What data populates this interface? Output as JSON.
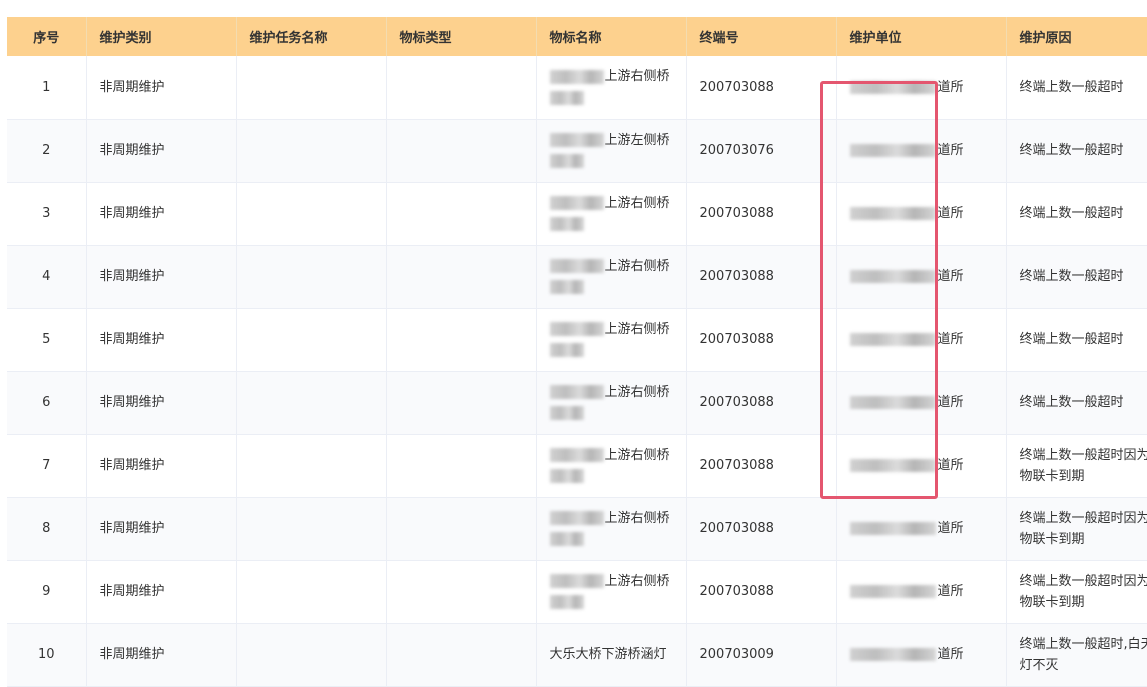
{
  "table": {
    "columns": [
      "序号",
      "维护类别",
      "维护任务名称",
      "物标类型",
      "物标名称",
      "终端号",
      "维护单位",
      "维护原因"
    ],
    "rows": [
      {
        "idx": "1",
        "category": "非周期维护",
        "task": "",
        "type": "",
        "name_suffix": "上游右侧桥",
        "name": "",
        "terminal": "200703088",
        "unit_suffix": "道所",
        "reason": "终端上数一般超时"
      },
      {
        "idx": "2",
        "category": "非周期维护",
        "task": "",
        "type": "",
        "name_suffix": "上游左侧桥",
        "name": "",
        "terminal": "200703076",
        "unit_suffix": "道所",
        "reason": "终端上数一般超时"
      },
      {
        "idx": "3",
        "category": "非周期维护",
        "task": "",
        "type": "",
        "name_suffix": "上游右侧桥",
        "name": "",
        "terminal": "200703088",
        "unit_suffix": "道所",
        "reason": "终端上数一般超时"
      },
      {
        "idx": "4",
        "category": "非周期维护",
        "task": "",
        "type": "",
        "name_suffix": "上游右侧桥",
        "name": "",
        "terminal": "200703088",
        "unit_suffix": "道所",
        "reason": "终端上数一般超时"
      },
      {
        "idx": "5",
        "category": "非周期维护",
        "task": "",
        "type": "",
        "name_suffix": "上游右侧桥",
        "name": "",
        "terminal": "200703088",
        "unit_suffix": "道所",
        "reason": "终端上数一般超时"
      },
      {
        "idx": "6",
        "category": "非周期维护",
        "task": "",
        "type": "",
        "name_suffix": "上游右侧桥",
        "name": "",
        "terminal": "200703088",
        "unit_suffix": "道所",
        "reason": "终端上数一般超时"
      },
      {
        "idx": "7",
        "category": "非周期维护",
        "task": "",
        "type": "",
        "name_suffix": "上游右侧桥",
        "name": "",
        "terminal": "200703088",
        "unit_suffix": "道所",
        "reason": "终端上数一般超时因为物联卡到期"
      },
      {
        "idx": "8",
        "category": "非周期维护",
        "task": "",
        "type": "",
        "name_suffix": "上游右侧桥",
        "name": "",
        "terminal": "200703088",
        "unit_suffix": "道所",
        "reason": "终端上数一般超时因为物联卡到期"
      },
      {
        "idx": "9",
        "category": "非周期维护",
        "task": "",
        "type": "",
        "name_suffix": "上游右侧桥",
        "name": "",
        "terminal": "200703088",
        "unit_suffix": "道所",
        "reason": "终端上数一般超时因为物联卡到期"
      },
      {
        "idx": "10",
        "category": "非周期维护",
        "task": "",
        "type": "",
        "name_suffix": "",
        "name": "大乐大桥下游桥涵灯",
        "terminal": "200703009",
        "unit_suffix": "道所",
        "reason": "终端上数一般超时,白天灯不灭"
      }
    ]
  },
  "colors": {
    "header_bg": "#fdd18e",
    "stripe_bg": "#f9fafc",
    "highlight": "#e4566f"
  }
}
